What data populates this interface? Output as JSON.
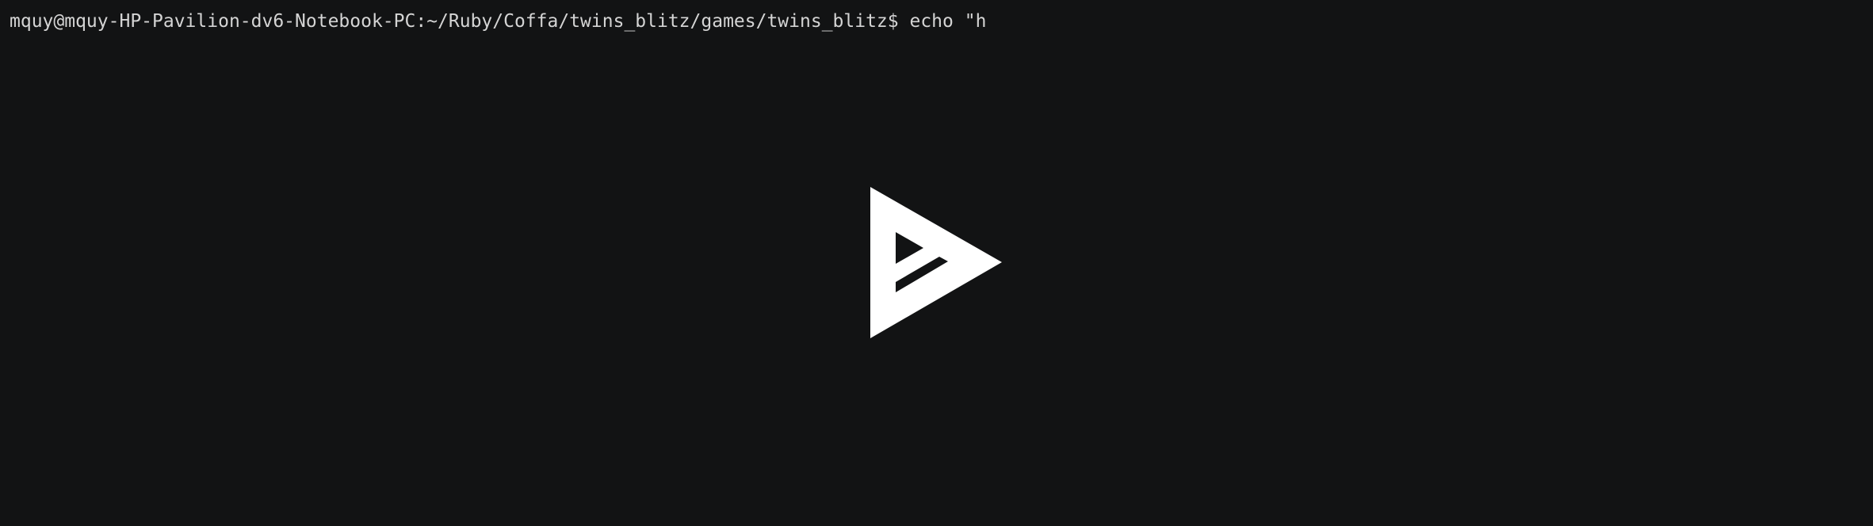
{
  "terminal": {
    "prompt": "mquy@mquy-HP-Pavilion-dv6-Notebook-PC:~/Ruby/Coffa/twins_blitz/games/twins_blitz$",
    "command": "echo \"h"
  },
  "player": {
    "overlay_icon": "asciinema-play-icon",
    "background_color": "#121314",
    "text_color": "#d4d4d4",
    "icon_color": "#ffffff"
  }
}
